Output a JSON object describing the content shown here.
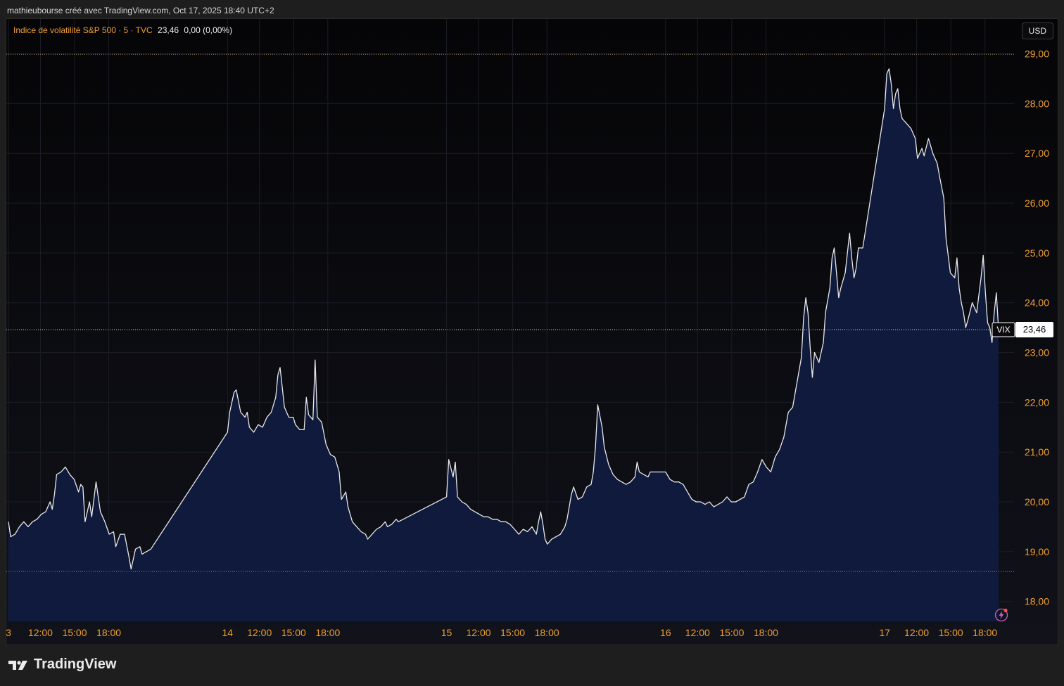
{
  "header": {
    "caption": "mathieubourse créé avec TradingView.com, Oct 17, 2025 18:40 UTC+2"
  },
  "legend": {
    "title": "Indice de volatilité S&P 500 · 5 · TVC",
    "last": "23,46",
    "change": "0,00 (0,00%)"
  },
  "currency_button": "USD",
  "price_label": {
    "symbol": "VIX",
    "value": "23,46"
  },
  "footer": {
    "brand": "TradingView"
  },
  "icons": {
    "logo": "tradingview-logo-icon",
    "alert": "lightning-alert-icon"
  },
  "colors": {
    "line": "#e8e8e8",
    "fill": "#0f1a3d",
    "axis_text": "#f0a030",
    "time_text": "#f0a030",
    "background": "#0b0b0e",
    "last_price_tag": "#ffffff"
  },
  "chart_data": {
    "type": "area",
    "title": "Indice de volatilité S&P 500 · 5 · TVC",
    "symbol": "VIX",
    "xlabel": "",
    "ylabel": "",
    "ylim": [
      17.6,
      29.7
    ],
    "yticks": [
      "18,00",
      "19,00",
      "20,00",
      "21,00",
      "22,00",
      "23,00",
      "24,00",
      "25,00",
      "26,00",
      "27,00",
      "28,00",
      "29,00"
    ],
    "ytick_values": [
      18,
      19,
      20,
      21,
      22,
      23,
      24,
      25,
      26,
      27,
      28,
      29
    ],
    "xticks": [
      {
        "label": "3",
        "day": 0.0
      },
      {
        "label": "12:00",
        "day": 0.146
      },
      {
        "label": "15:00",
        "day": 0.302
      },
      {
        "label": "18:00",
        "day": 0.458
      },
      {
        "label": "14",
        "day": 1.0
      },
      {
        "label": "12:00",
        "day": 1.146
      },
      {
        "label": "15:00",
        "day": 1.302
      },
      {
        "label": "18:00",
        "day": 1.458
      },
      {
        "label": "15",
        "day": 2.0
      },
      {
        "label": "12:00",
        "day": 2.146
      },
      {
        "label": "15:00",
        "day": 2.302
      },
      {
        "label": "18:00",
        "day": 2.458
      },
      {
        "label": "16",
        "day": 3.0
      },
      {
        "label": "12:00",
        "day": 3.146
      },
      {
        "label": "15:00",
        "day": 3.302
      },
      {
        "label": "18:00",
        "day": 3.458
      },
      {
        "label": "17",
        "day": 4.0
      },
      {
        "label": "12:00",
        "day": 4.146
      },
      {
        "label": "15:00",
        "day": 4.302
      },
      {
        "label": "18:00",
        "day": 4.458
      }
    ],
    "xlim_day": [
      0.0,
      4.52
    ],
    "dotted_levels": [
      28.99,
      18.6
    ],
    "last_value": 23.46,
    "points": [
      [
        0.0,
        19.6
      ],
      [
        0.01,
        19.3
      ],
      [
        0.03,
        19.35
      ],
      [
        0.05,
        19.5
      ],
      [
        0.07,
        19.6
      ],
      [
        0.09,
        19.5
      ],
      [
        0.11,
        19.6
      ],
      [
        0.13,
        19.65
      ],
      [
        0.15,
        19.75
      ],
      [
        0.17,
        19.8
      ],
      [
        0.19,
        20.0
      ],
      [
        0.2,
        19.85
      ],
      [
        0.21,
        20.15
      ],
      [
        0.22,
        20.55
      ],
      [
        0.24,
        20.6
      ],
      [
        0.26,
        20.7
      ],
      [
        0.28,
        20.55
      ],
      [
        0.3,
        20.45
      ],
      [
        0.32,
        20.2
      ],
      [
        0.33,
        20.35
      ],
      [
        0.34,
        20.3
      ],
      [
        0.35,
        19.6
      ],
      [
        0.37,
        20.0
      ],
      [
        0.38,
        19.7
      ],
      [
        0.4,
        20.4
      ],
      [
        0.42,
        19.8
      ],
      [
        0.44,
        19.6
      ],
      [
        0.46,
        19.35
      ],
      [
        0.48,
        19.4
      ],
      [
        0.49,
        19.1
      ],
      [
        0.51,
        19.35
      ],
      [
        0.53,
        19.35
      ],
      [
        0.55,
        18.9
      ],
      [
        0.56,
        18.65
      ],
      [
        0.58,
        19.05
      ],
      [
        0.6,
        19.1
      ],
      [
        0.61,
        18.95
      ],
      [
        0.63,
        19.0
      ],
      [
        0.65,
        19.05
      ],
      [
        1.0,
        21.4
      ],
      [
        1.01,
        21.8
      ],
      [
        1.03,
        22.2
      ],
      [
        1.04,
        22.25
      ],
      [
        1.06,
        21.8
      ],
      [
        1.08,
        21.7
      ],
      [
        1.09,
        21.8
      ],
      [
        1.1,
        21.5
      ],
      [
        1.12,
        21.4
      ],
      [
        1.14,
        21.55
      ],
      [
        1.16,
        21.5
      ],
      [
        1.18,
        21.7
      ],
      [
        1.2,
        21.8
      ],
      [
        1.22,
        22.1
      ],
      [
        1.23,
        22.55
      ],
      [
        1.24,
        22.7
      ],
      [
        1.26,
        21.9
      ],
      [
        1.28,
        21.7
      ],
      [
        1.3,
        21.7
      ],
      [
        1.31,
        21.55
      ],
      [
        1.33,
        21.45
      ],
      [
        1.35,
        21.45
      ],
      [
        1.36,
        22.1
      ],
      [
        1.37,
        21.75
      ],
      [
        1.39,
        21.65
      ],
      [
        1.4,
        22.85
      ],
      [
        1.41,
        21.7
      ],
      [
        1.43,
        21.6
      ],
      [
        1.45,
        21.15
      ],
      [
        1.47,
        20.95
      ],
      [
        1.49,
        20.9
      ],
      [
        1.51,
        20.6
      ],
      [
        1.52,
        20.05
      ],
      [
        1.54,
        20.2
      ],
      [
        1.55,
        19.9
      ],
      [
        1.57,
        19.6
      ],
      [
        1.59,
        19.5
      ],
      [
        1.61,
        19.4
      ],
      [
        1.63,
        19.35
      ],
      [
        1.64,
        19.25
      ],
      [
        1.66,
        19.35
      ],
      [
        1.68,
        19.45
      ],
      [
        1.7,
        19.5
      ],
      [
        1.72,
        19.6
      ],
      [
        1.73,
        19.5
      ],
      [
        1.75,
        19.55
      ],
      [
        1.77,
        19.65
      ],
      [
        1.78,
        19.6
      ],
      [
        2.0,
        20.1
      ],
      [
        2.01,
        20.85
      ],
      [
        2.03,
        20.5
      ],
      [
        2.04,
        20.8
      ],
      [
        2.05,
        20.1
      ],
      [
        2.07,
        20.0
      ],
      [
        2.09,
        19.95
      ],
      [
        2.11,
        19.85
      ],
      [
        2.13,
        19.8
      ],
      [
        2.15,
        19.75
      ],
      [
        2.17,
        19.7
      ],
      [
        2.19,
        19.7
      ],
      [
        2.21,
        19.65
      ],
      [
        2.23,
        19.65
      ],
      [
        2.25,
        19.6
      ],
      [
        2.27,
        19.6
      ],
      [
        2.29,
        19.55
      ],
      [
        2.31,
        19.45
      ],
      [
        2.33,
        19.35
      ],
      [
        2.35,
        19.45
      ],
      [
        2.37,
        19.4
      ],
      [
        2.39,
        19.5
      ],
      [
        2.41,
        19.35
      ],
      [
        2.42,
        19.6
      ],
      [
        2.43,
        19.8
      ],
      [
        2.44,
        19.55
      ],
      [
        2.45,
        19.25
      ],
      [
        2.46,
        19.15
      ],
      [
        2.48,
        19.25
      ],
      [
        2.5,
        19.3
      ],
      [
        2.52,
        19.35
      ],
      [
        2.54,
        19.5
      ],
      [
        2.55,
        19.65
      ],
      [
        2.57,
        20.15
      ],
      [
        2.58,
        20.3
      ],
      [
        2.6,
        20.05
      ],
      [
        2.62,
        20.1
      ],
      [
        2.64,
        20.3
      ],
      [
        2.66,
        20.35
      ],
      [
        2.67,
        20.6
      ],
      [
        2.68,
        21.1
      ],
      [
        2.69,
        21.95
      ],
      [
        2.71,
        21.5
      ],
      [
        2.72,
        21.1
      ],
      [
        2.74,
        20.75
      ],
      [
        2.76,
        20.55
      ],
      [
        2.78,
        20.45
      ],
      [
        2.8,
        20.4
      ],
      [
        2.82,
        20.35
      ],
      [
        2.84,
        20.4
      ],
      [
        2.86,
        20.5
      ],
      [
        2.87,
        20.8
      ],
      [
        2.88,
        20.6
      ],
      [
        2.9,
        20.55
      ],
      [
        2.92,
        20.5
      ],
      [
        2.93,
        20.6
      ],
      [
        3.0,
        20.6
      ],
      [
        3.02,
        20.45
      ],
      [
        3.04,
        20.4
      ],
      [
        3.06,
        20.4
      ],
      [
        3.08,
        20.35
      ],
      [
        3.1,
        20.2
      ],
      [
        3.12,
        20.05
      ],
      [
        3.14,
        20.0
      ],
      [
        3.16,
        20.0
      ],
      [
        3.18,
        19.95
      ],
      [
        3.2,
        20.0
      ],
      [
        3.22,
        19.9
      ],
      [
        3.24,
        19.95
      ],
      [
        3.26,
        20.0
      ],
      [
        3.28,
        20.1
      ],
      [
        3.3,
        20.0
      ],
      [
        3.32,
        20.0
      ],
      [
        3.34,
        20.05
      ],
      [
        3.36,
        20.1
      ],
      [
        3.38,
        20.35
      ],
      [
        3.4,
        20.4
      ],
      [
        3.42,
        20.6
      ],
      [
        3.44,
        20.85
      ],
      [
        3.46,
        20.7
      ],
      [
        3.48,
        20.6
      ],
      [
        3.5,
        20.9
      ],
      [
        3.52,
        21.05
      ],
      [
        3.54,
        21.3
      ],
      [
        3.56,
        21.8
      ],
      [
        3.58,
        21.9
      ],
      [
        3.6,
        22.4
      ],
      [
        3.62,
        22.9
      ],
      [
        3.63,
        23.7
      ],
      [
        3.64,
        24.1
      ],
      [
        3.65,
        23.8
      ],
      [
        3.66,
        23.1
      ],
      [
        3.67,
        22.5
      ],
      [
        3.68,
        23.0
      ],
      [
        3.7,
        22.8
      ],
      [
        3.72,
        23.2
      ],
      [
        3.73,
        23.8
      ],
      [
        3.75,
        24.3
      ],
      [
        3.76,
        24.9
      ],
      [
        3.77,
        25.1
      ],
      [
        3.78,
        24.6
      ],
      [
        3.79,
        24.1
      ],
      [
        3.8,
        24.3
      ],
      [
        3.82,
        24.6
      ],
      [
        3.84,
        25.4
      ],
      [
        3.85,
        24.9
      ],
      [
        3.86,
        24.5
      ],
      [
        3.87,
        24.7
      ],
      [
        3.88,
        25.1
      ],
      [
        3.9,
        25.1
      ],
      [
        4.0,
        27.9
      ],
      [
        4.01,
        28.6
      ],
      [
        4.02,
        28.7
      ],
      [
        4.03,
        28.4
      ],
      [
        4.04,
        27.9
      ],
      [
        4.05,
        28.2
      ],
      [
        4.06,
        28.3
      ],
      [
        4.07,
        27.9
      ],
      [
        4.08,
        27.7
      ],
      [
        4.1,
        27.6
      ],
      [
        4.12,
        27.5
      ],
      [
        4.14,
        27.3
      ],
      [
        4.15,
        26.9
      ],
      [
        4.17,
        27.1
      ],
      [
        4.18,
        26.95
      ],
      [
        4.2,
        27.3
      ],
      [
        4.22,
        27.0
      ],
      [
        4.24,
        26.8
      ],
      [
        4.25,
        26.55
      ],
      [
        4.27,
        26.1
      ],
      [
        4.28,
        25.3
      ],
      [
        4.3,
        24.6
      ],
      [
        4.32,
        24.5
      ],
      [
        4.33,
        24.9
      ],
      [
        4.34,
        24.3
      ],
      [
        4.35,
        24.0
      ],
      [
        4.36,
        23.8
      ],
      [
        4.37,
        23.5
      ],
      [
        4.38,
        23.65
      ],
      [
        4.4,
        24.0
      ],
      [
        4.42,
        23.8
      ],
      [
        4.44,
        24.5
      ],
      [
        4.45,
        24.95
      ],
      [
        4.46,
        24.2
      ],
      [
        4.47,
        23.6
      ],
      [
        4.48,
        23.5
      ],
      [
        4.49,
        23.2
      ],
      [
        4.5,
        23.8
      ],
      [
        4.51,
        24.2
      ],
      [
        4.52,
        23.46
      ]
    ]
  }
}
